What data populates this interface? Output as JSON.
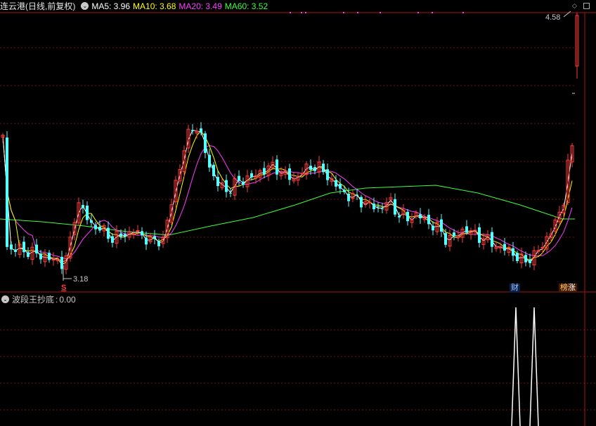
{
  "header": {
    "stock_title": "连云港(日线,前复权)",
    "ma5": "MA5: 3.96",
    "ma10": "MA10: 3.68",
    "ma20": "MA20: 3.49",
    "ma60": "MA60: 3.52"
  },
  "colors": {
    "up": "#ff3c3c",
    "down": "#54ffff",
    "ma5": "#ffffff",
    "ma10": "#ffff00",
    "ma20": "#ff3cff",
    "ma60": "#3cff3c",
    "grid": "#7a1010",
    "axis": "#aa1515"
  },
  "markers": {
    "high_label": "4.58",
    "low_label": "3.18",
    "s_signal": "S",
    "cai_badge": "财",
    "bang_badge": "榜",
    "zhang_badge": "涨"
  },
  "indicator": {
    "name": "波段王抄底",
    "value": "0.00"
  },
  "icons": {
    "title_toggle": "chevron-circle-icon",
    "indicator_toggle": "chevron-circle-icon",
    "corner_buttons": [
      "diamond-icon",
      "square-icon"
    ]
  },
  "chart_data": {
    "type": "candlestick",
    "price_range": [
      3.18,
      4.58
    ],
    "ma_series": [
      {
        "name": "MA5",
        "value": 3.96
      },
      {
        "name": "MA10",
        "value": 3.68
      },
      {
        "name": "MA20",
        "value": 3.49
      },
      {
        "name": "MA60",
        "value": 3.52
      }
    ],
    "sub_indicator": {
      "name": "波段王抄底",
      "value": 0.0
    }
  }
}
